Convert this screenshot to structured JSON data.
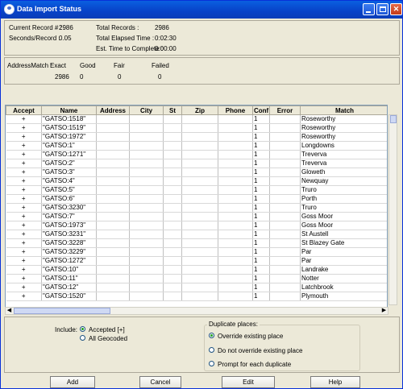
{
  "window": {
    "title": "Data Import Status"
  },
  "stats": {
    "current_record_label": "Current Record # :",
    "current_record_value": "2986",
    "seconds_per_record_label": "Seconds/Record :",
    "seconds_per_record_value": "0.05",
    "total_records_label": "Total Records :",
    "total_records_value": "2986",
    "total_elapsed_label": "Total Elapsed Time :",
    "total_elapsed_value": "0:02:30",
    "est_time_label": "Est. Time to Complete :",
    "est_time_value": "0:00:00"
  },
  "address_match": {
    "label": "AddressMatch :",
    "columns": [
      "Exact",
      "Good",
      "Fair",
      "Failed"
    ],
    "values": [
      "2986",
      "0",
      "0",
      "0"
    ]
  },
  "table": {
    "columns": [
      "Accept",
      "Name",
      "Address",
      "City",
      "St",
      "Zip",
      "Phone",
      "Conf",
      "Error",
      "Match"
    ],
    "rows": [
      [
        "+",
        "\"GATSO:1518\"",
        "",
        "",
        "",
        "",
        "",
        "1",
        "",
        "Roseworthy"
      ],
      [
        "+",
        "\"GATSO:1519\"",
        "",
        "",
        "",
        "",
        "",
        "1",
        "",
        "Roseworthy"
      ],
      [
        "+",
        "\"GATSO:1972\"",
        "",
        "",
        "",
        "",
        "",
        "1",
        "",
        "Roseworthy"
      ],
      [
        "+",
        "\"GATSO:1\"",
        "",
        "",
        "",
        "",
        "",
        "1",
        "",
        "Longdowns"
      ],
      [
        "+",
        "\"GATSO:1271\"",
        "",
        "",
        "",
        "",
        "",
        "1",
        "",
        "Treverva"
      ],
      [
        "+",
        "\"GATSO:2\"",
        "",
        "",
        "",
        "",
        "",
        "1",
        "",
        "Treverva"
      ],
      [
        "+",
        "\"GATSO:3\"",
        "",
        "",
        "",
        "",
        "",
        "1",
        "",
        "Gloweth"
      ],
      [
        "+",
        "\"GATSO:4\"",
        "",
        "",
        "",
        "",
        "",
        "1",
        "",
        "Newquay"
      ],
      [
        "+",
        "\"GATSO:5\"",
        "",
        "",
        "",
        "",
        "",
        "1",
        "",
        "Truro"
      ],
      [
        "+",
        "\"GATSO:6\"",
        "",
        "",
        "",
        "",
        "",
        "1",
        "",
        "Porth"
      ],
      [
        "+",
        "\"GATSO:3230\"",
        "",
        "",
        "",
        "",
        "",
        "1",
        "",
        "Truro"
      ],
      [
        "+",
        "\"GATSO:7\"",
        "",
        "",
        "",
        "",
        "",
        "1",
        "",
        "Goss Moor"
      ],
      [
        "+",
        "\"GATSO:1973\"",
        "",
        "",
        "",
        "",
        "",
        "1",
        "",
        "Goss Moor"
      ],
      [
        "+",
        "\"GATSO:3231\"",
        "",
        "",
        "",
        "",
        "",
        "1",
        "",
        "St Austell"
      ],
      [
        "+",
        "\"GATSO:3228\"",
        "",
        "",
        "",
        "",
        "",
        "1",
        "",
        "St Blazey Gate"
      ],
      [
        "+",
        "\"GATSO:3229\"",
        "",
        "",
        "",
        "",
        "",
        "1",
        "",
        "Par"
      ],
      [
        "+",
        "\"GATSO:1272\"",
        "",
        "",
        "",
        "",
        "",
        "1",
        "",
        "Par"
      ],
      [
        "+",
        "\"GATSO:10\"",
        "",
        "",
        "",
        "",
        "",
        "1",
        "",
        "Landrake"
      ],
      [
        "+",
        "\"GATSO:11\"",
        "",
        "",
        "",
        "",
        "",
        "1",
        "",
        "Notter"
      ],
      [
        "+",
        "\"GATSO:12\"",
        "",
        "",
        "",
        "",
        "",
        "1",
        "",
        "Latchbrook"
      ],
      [
        "+",
        "\"GATSO:1520\"",
        "",
        "",
        "",
        "",
        "",
        "1",
        "",
        "Plymouth"
      ]
    ]
  },
  "include": {
    "label": "Include:",
    "options": [
      "Accepted [+]",
      "All Geocoded"
    ],
    "selected": "Accepted [+]"
  },
  "duplicates": {
    "title": "Duplicate places:",
    "options": [
      "Override existing place",
      "Do not override existing place",
      "Prompt for each duplicate"
    ],
    "selected": "Override existing place"
  },
  "buttons": {
    "add": "Add",
    "cancel": "Cancel",
    "edit": "Edit",
    "help": "Help"
  },
  "colors": {
    "titlebar": "#0a4fd6",
    "window_bg": "#ece9d8",
    "grid_bg": "#ffffff"
  }
}
